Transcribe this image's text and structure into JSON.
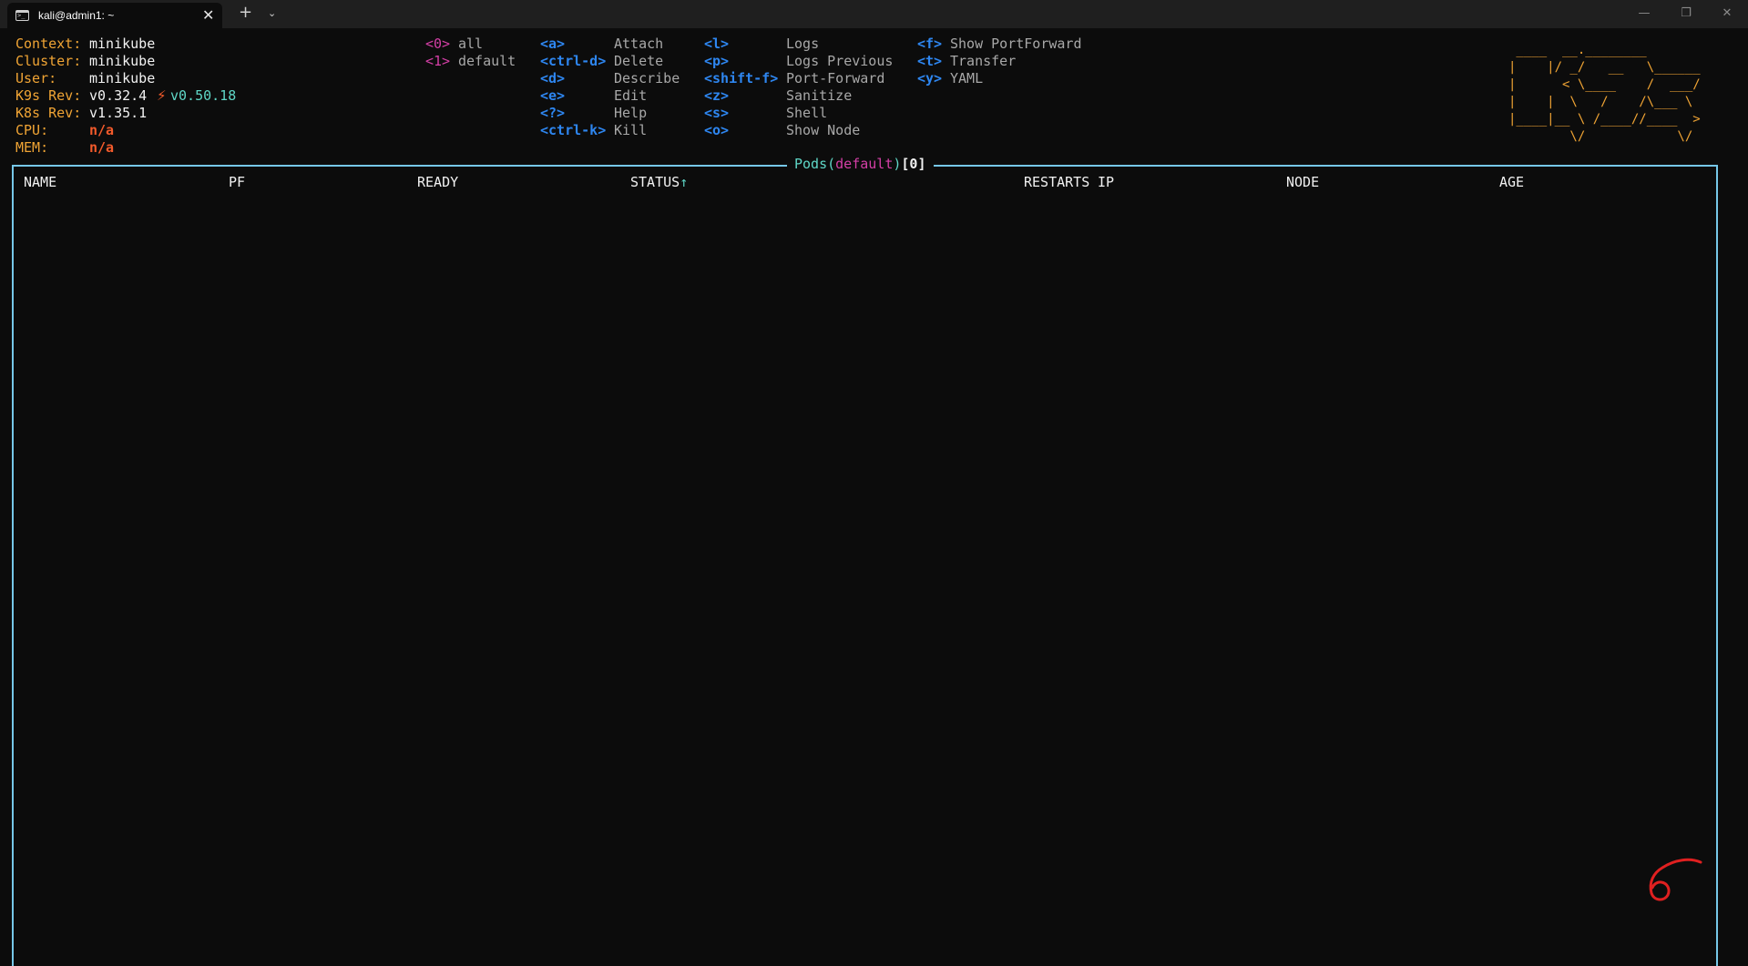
{
  "window": {
    "tab_title": "kali@admin1: ~",
    "tab_close": "✕",
    "new_tab": "+",
    "tab_dropdown": "⌄",
    "minimize": "—",
    "maximize": "❐",
    "close": "✕"
  },
  "cluster_info": {
    "context_label": "Context:",
    "context": "minikube",
    "cluster_label": "Cluster:",
    "cluster": "minikube",
    "user_label": "User:",
    "user": "minikube",
    "k9s_rev_label": "K9s Rev:",
    "k9s_rev": "v0.32.4",
    "k9s_update_icon": "⚡",
    "k9s_update": "v0.50.18",
    "k8s_rev_label": "K8s Rev:",
    "k8s_rev": "v1.35.1",
    "cpu_label": "CPU:",
    "cpu": "n/a",
    "mem_label": "MEM:",
    "mem": "n/a"
  },
  "namespaces": [
    {
      "key": "<0>",
      "label": "all"
    },
    {
      "key": "<1>",
      "label": "default"
    }
  ],
  "hotkeys_col1": [
    {
      "key": "<a>",
      "label": "Attach"
    },
    {
      "key": "<ctrl-d>",
      "label": "Delete"
    },
    {
      "key": "<d>",
      "label": "Describe"
    },
    {
      "key": "<e>",
      "label": "Edit"
    },
    {
      "key": "<?>",
      "label": "Help"
    },
    {
      "key": "<ctrl-k>",
      "label": "Kill"
    }
  ],
  "hotkeys_col2": [
    {
      "key": "<l>",
      "label": "Logs"
    },
    {
      "key": "<p>",
      "label": "Logs Previous"
    },
    {
      "key": "<shift-f>",
      "label": "Port-Forward"
    },
    {
      "key": "<z>",
      "label": "Sanitize"
    },
    {
      "key": "<s>",
      "label": "Shell"
    },
    {
      "key": "<o>",
      "label": "Show Node"
    }
  ],
  "hotkeys_col3": [
    {
      "key": "<f>",
      "label": "Show PortForward"
    },
    {
      "key": "<t>",
      "label": "Transfer"
    },
    {
      "key": "<y>",
      "label": "YAML"
    }
  ],
  "logo": {
    "line1": " ____  __.________       ",
    "line2": "|    |/ _/   __   \\______",
    "line3": "|      < \\____    /  ___/",
    "line4": "|    |  \\   /    /\\___ \\ ",
    "line5": "|____|__ \\ /____//____  >",
    "line6": "        \\/            \\/ "
  },
  "table": {
    "resource": "Pods",
    "open_paren": "(",
    "namespace": "default",
    "close_paren": ")",
    "count": "[0]",
    "columns": [
      "NAME",
      "PF",
      "READY",
      "STATUS",
      "RESTARTS",
      "IP",
      "NODE",
      "AGE"
    ],
    "sort_indicator": "↑",
    "rows": []
  },
  "colors": {
    "orange": "#f0a434",
    "cyan": "#5fd7c7",
    "blue": "#2e86f0",
    "magenta": "#d43fa6",
    "red": "#f25a2b",
    "frame": "#76c7e8",
    "annotation": "#e02020"
  },
  "annotation": {
    "text": "6",
    "kind": "handwritten red mark"
  }
}
